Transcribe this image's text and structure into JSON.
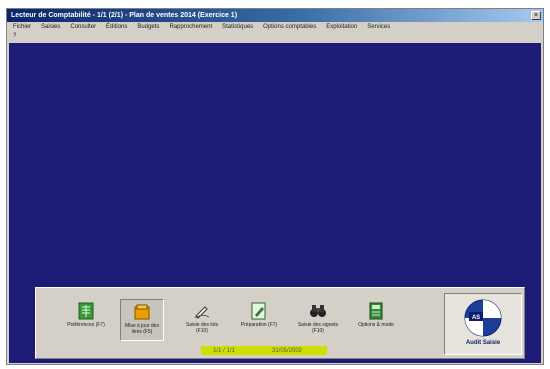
{
  "window": {
    "title": "Lecteur de Comptabilité - 1/1 (2/1) - Plan de ventes 2014 (Exercice 1)",
    "control_glyph": "_ □ ×"
  },
  "menu": {
    "row1": [
      "Fichier",
      "Saisies",
      "Consulter",
      "Éditions",
      "Budgets",
      "Rapprochement",
      "Statistiques",
      "Options comptables",
      "Exploitation",
      "Services"
    ],
    "row2": [
      "?"
    ]
  },
  "toolbar": {
    "buttons": [
      {
        "label": "Préférences (F7)",
        "icon": "grid-book-icon",
        "color": "#3a9a3a"
      },
      {
        "label": "Mise à jour des liens (F5)",
        "icon": "folder-stack-icon",
        "color": "#e8a000"
      },
      {
        "label": "Saisie des lots (F10)",
        "icon": "pen-writing-icon",
        "color": "#333333"
      },
      {
        "label": "Préparation (F7)",
        "icon": "edit-document-icon",
        "color": "#3a7a3a"
      },
      {
        "label": "Saisie des signets (F10)",
        "icon": "binoculars-icon",
        "color": "#222222"
      },
      {
        "label": "Options & mode",
        "icon": "book-settings-icon",
        "color": "#3a8a3a"
      }
    ],
    "active_index": 1
  },
  "status": {
    "left": "1/1 / 1/1",
    "right": "31/05/2002"
  },
  "brand": {
    "name": "Audit Saisie"
  }
}
